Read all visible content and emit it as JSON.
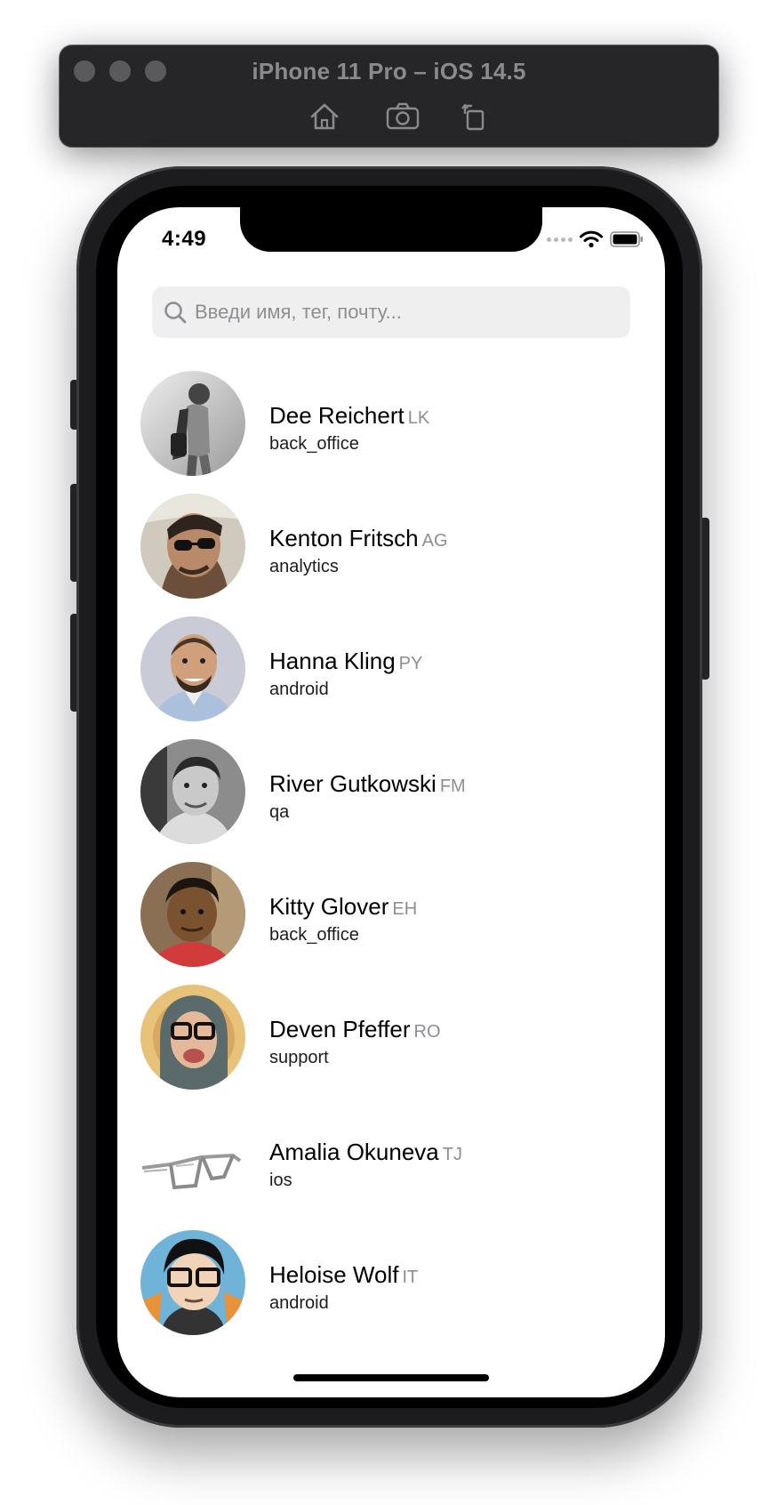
{
  "simulator": {
    "title": "iPhone 11 Pro – iOS 14.5",
    "tools": [
      "home-icon",
      "screenshot-icon",
      "rotate-icon"
    ]
  },
  "status_bar": {
    "time": "4:49",
    "icons": [
      "cellular-dots-icon",
      "wifi-icon",
      "battery-icon"
    ]
  },
  "search": {
    "placeholder": "Введи имя, тег, почту...",
    "value": ""
  },
  "employees": [
    {
      "name": "Dee Reichert",
      "code": "LK",
      "department": "back_office",
      "avatar": "photo"
    },
    {
      "name": "Kenton Fritsch",
      "code": "AG",
      "department": "analytics",
      "avatar": "photo"
    },
    {
      "name": "Hanna Kling",
      "code": "PY",
      "department": "android",
      "avatar": "photo"
    },
    {
      "name": "River Gutkowski",
      "code": "FM",
      "department": "qa",
      "avatar": "photo"
    },
    {
      "name": "Kitty Glover",
      "code": "EH",
      "department": "back_office",
      "avatar": "photo"
    },
    {
      "name": "Deven Pfeffer",
      "code": "RO",
      "department": "support",
      "avatar": "photo"
    },
    {
      "name": "Amalia Okuneva",
      "code": "TJ",
      "department": "ios",
      "avatar": "glasses-sketch"
    },
    {
      "name": "Heloise Wolf",
      "code": "IT",
      "department": "android",
      "avatar": "cartoon"
    }
  ],
  "colors": {
    "accent_gray": "#8e8e93",
    "search_bg": "#efeff0",
    "simulator_bar": "#262628"
  }
}
